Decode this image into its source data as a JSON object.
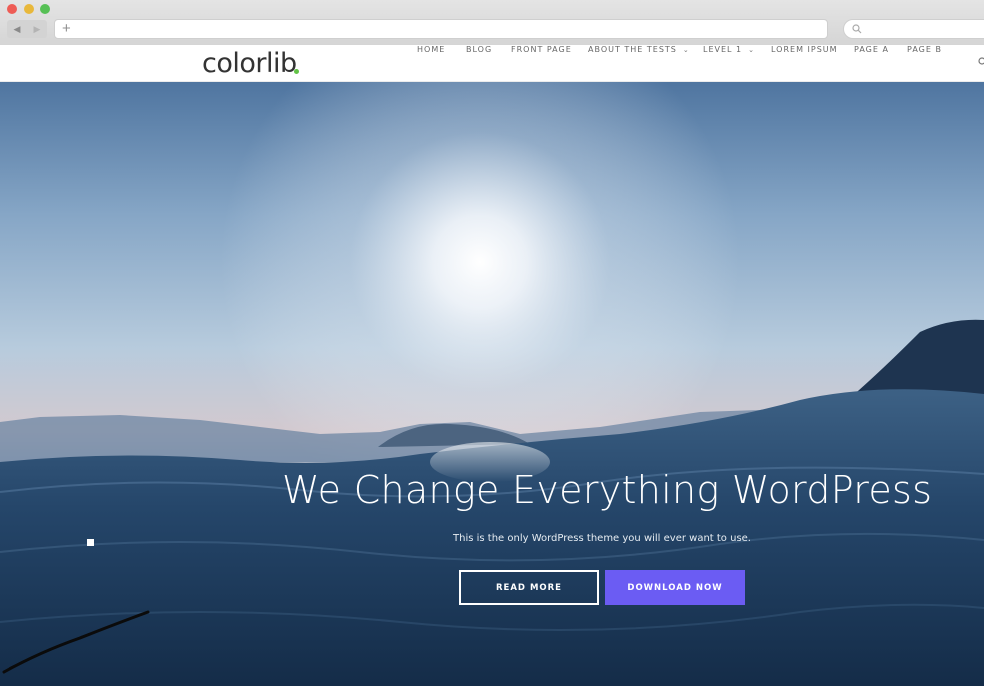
{
  "browser": {
    "back_glyph": "◀",
    "forward_glyph": "▶",
    "new_tab_glyph": "+",
    "icons": [
      "close-dot",
      "minimize-dot",
      "maximize-dot",
      "search-icon"
    ]
  },
  "header": {
    "logo": "colorlib",
    "logo_accent_color": "#62c346",
    "menu": [
      {
        "label": "HOME"
      },
      {
        "label": "BLOG"
      },
      {
        "label": "FRONT PAGE"
      },
      {
        "label": "ABOUT THE TESTS",
        "caret": "⌄"
      },
      {
        "label": "LEVEL 1",
        "caret": "⌄"
      },
      {
        "label": "LOREM IPSUM"
      },
      {
        "label": "PAGE A"
      },
      {
        "label": "PAGE B"
      }
    ]
  },
  "hero": {
    "title": "We Change Everything WordPress",
    "subtitle": "This is the only WordPress theme you will ever want to use.",
    "read_more": "READ MORE",
    "download_now": "DOWNLOAD NOW",
    "accent_color": "#6b5cf3"
  }
}
